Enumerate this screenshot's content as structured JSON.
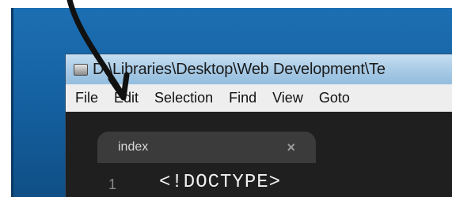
{
  "window": {
    "title": "D:\\Libraries\\Desktop\\Web Development\\Te"
  },
  "menu": [
    "File",
    "Edit",
    "Selection",
    "Find",
    "View",
    "Goto"
  ],
  "tab": {
    "label": "index",
    "close": "×"
  },
  "editor": {
    "line_number": "1",
    "code": "<!DOCTYPE>"
  },
  "annotation": {
    "arrow_color": "#111111"
  }
}
